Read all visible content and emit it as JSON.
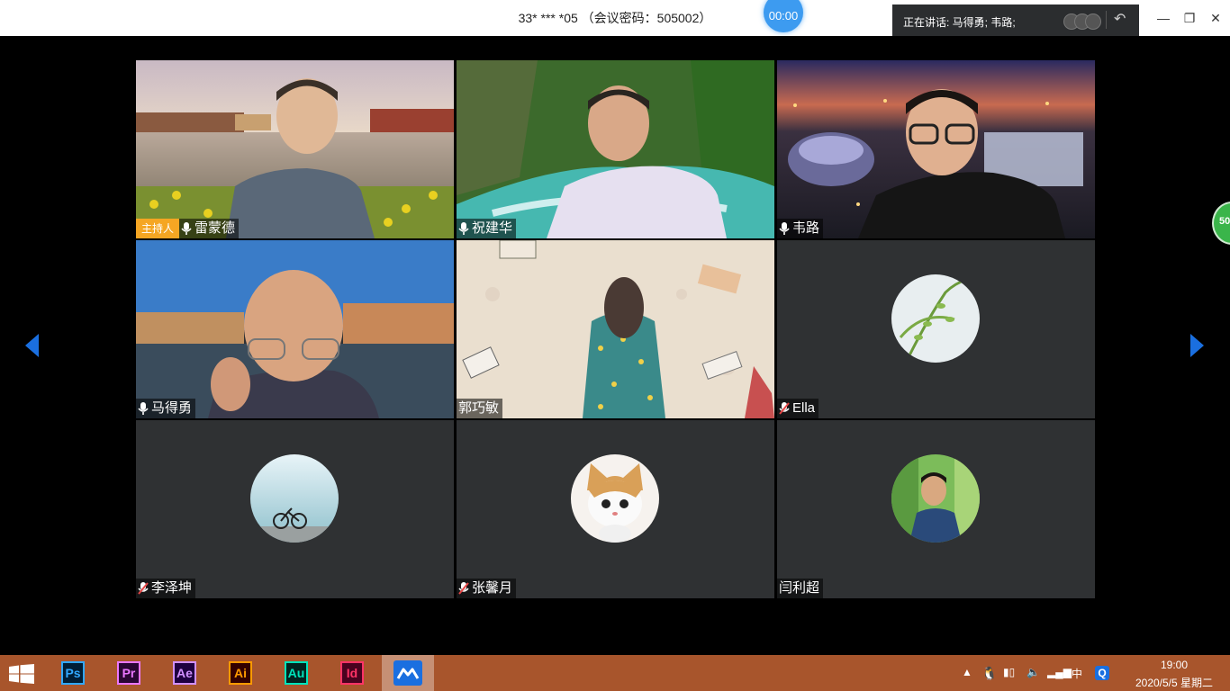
{
  "titlebar": {
    "meeting_title": "33* *** *05 （会议密码：505002）",
    "timer": "00:00",
    "speaking_text": "正在讲话: 马得勇; 韦路;"
  },
  "participants": [
    {
      "name": "雷蒙德",
      "host_badge": "主持人",
      "mic": "on",
      "bg": "campus-lake"
    },
    {
      "name": "祝建华",
      "mic": "on",
      "bg": "river-forest"
    },
    {
      "name": "韦路",
      "mic": "on",
      "bg": "city-night"
    },
    {
      "name": "马得勇",
      "mic": "on",
      "bg": "canal-town"
    },
    {
      "name": "郭巧敏",
      "mic": "none",
      "bg": "illustration-girl-books"
    },
    {
      "name": "Ella",
      "mic": "muted",
      "avatar": "plant-avatar"
    },
    {
      "name": "李泽坤",
      "mic": "muted",
      "avatar": "bicycle-avatar"
    },
    {
      "name": "张馨月",
      "mic": "muted",
      "avatar": "cat-avatar"
    },
    {
      "name": "闫利超",
      "mic": "none",
      "avatar": "person-avatar"
    }
  ],
  "side_badge": "50",
  "taskbar": {
    "apps": [
      "Ps",
      "Pr",
      "Ae",
      "Ai",
      "Au",
      "Id"
    ],
    "app_colors": [
      "#31a8ff",
      "#ea77ff",
      "#d291ff",
      "#ff9a00",
      "#00e4bb",
      "#ff3366"
    ],
    "tray_ime": "中",
    "clock_time": "19:00",
    "clock_date": "2020/5/5 星期二"
  },
  "colors": {
    "accent_blue": "#1a6fe0",
    "host_orange": "#f5a623",
    "taskbar": "#a8552c"
  }
}
